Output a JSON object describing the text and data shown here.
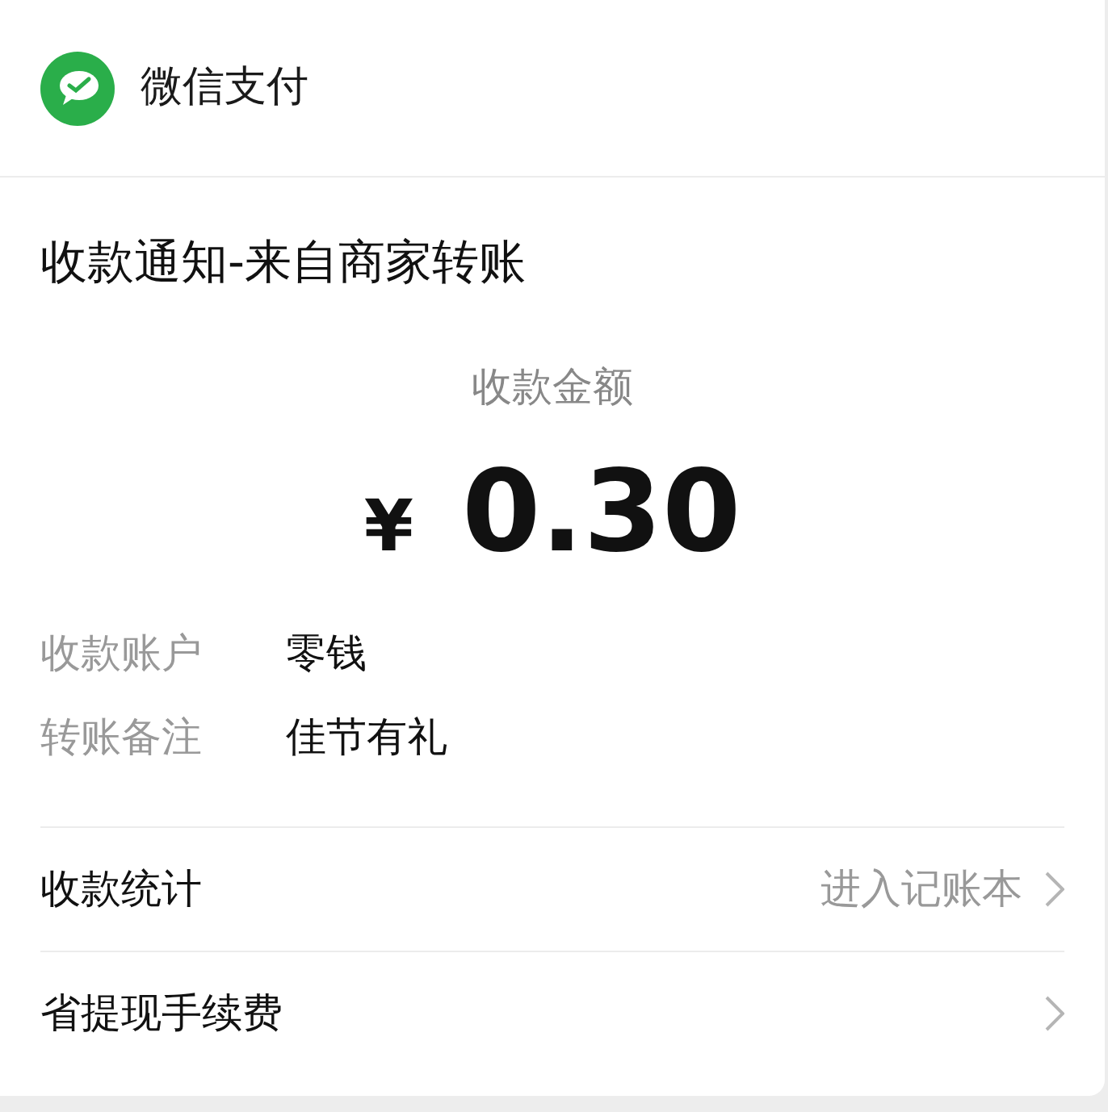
{
  "header": {
    "app_name": "微信支付"
  },
  "notice": {
    "title": "收款通知-来自商家转账",
    "amount_label": "收款金额",
    "currency": "¥",
    "amount": "0.30",
    "details": [
      {
        "label": "收款账户",
        "value": "零钱"
      },
      {
        "label": "转账备注",
        "value": "佳节有礼"
      }
    ]
  },
  "links": [
    {
      "label": "收款统计",
      "hint": "进入记账本"
    },
    {
      "label": "省提现手续费"
    }
  ]
}
